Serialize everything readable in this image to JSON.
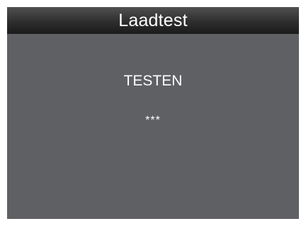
{
  "header": {
    "title": "Laadtest"
  },
  "main": {
    "status": "TESTEN",
    "progress_indicator": "***"
  },
  "colors": {
    "screen_background": "#5f6063",
    "title_bar": "#2e2e2e",
    "text": "#ffffff"
  }
}
